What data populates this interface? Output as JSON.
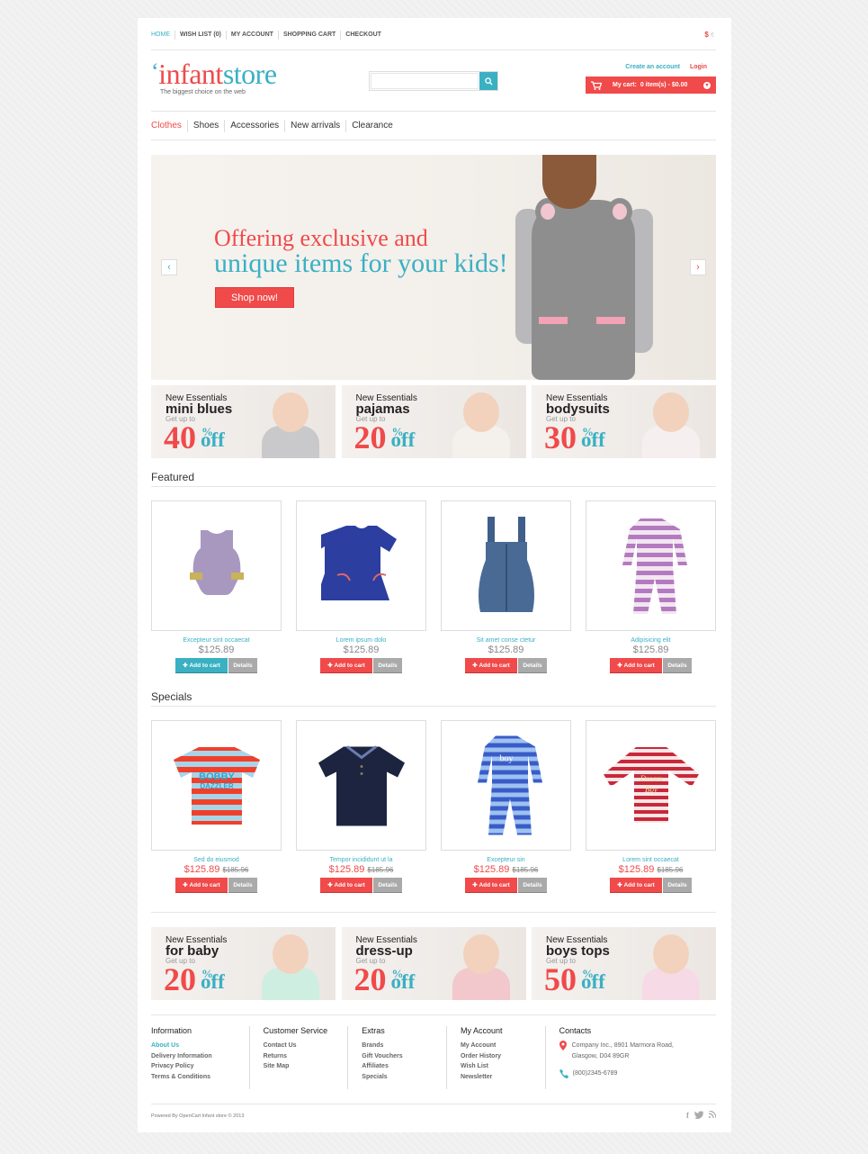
{
  "topnav": {
    "items": [
      "HOME",
      "WISH LIST (0)",
      "MY ACCOUNT",
      "SHOPPING CART",
      "CHECKOUT"
    ],
    "currency": "$",
    "currency_alt": "€"
  },
  "header": {
    "logo_quote": "‘",
    "logo_part1": "infant",
    "logo_part2": "store",
    "tagline": "The biggest choice on the web",
    "search_placeholder": "",
    "search_icon": "search-icon",
    "create_account": "Create an account",
    "login": "Login",
    "cart_label": "My cart:",
    "cart_value": "0 item(s) - $0.00"
  },
  "mainnav": [
    "Clothes",
    "Shoes",
    "Accessories",
    "New arrivals",
    "Clearance"
  ],
  "slider": {
    "line1": "Offering exclusive and",
    "line2": "unique items for your kids!",
    "button": "Shop now!",
    "prev": "‹",
    "next": "›"
  },
  "banners_top": [
    {
      "kicker": "New Essentials",
      "title": "mini blues",
      "sub": "Get up to",
      "pct": "40",
      "sym": "%",
      "off": "off"
    },
    {
      "kicker": "New Essentials",
      "title": "pajamas",
      "sub": "Get up to",
      "pct": "20",
      "sym": "%",
      "off": "off"
    },
    {
      "kicker": "New Essentials",
      "title": "bodysuits",
      "sub": "Get up to",
      "pct": "30",
      "sym": "%",
      "off": "off"
    }
  ],
  "featured": {
    "title": "Featured",
    "products": [
      {
        "name": "Excepteur sint occaecat",
        "price": "$125.89",
        "add": "Add to cart",
        "details": "Details"
      },
      {
        "name": "Lorem ipsum dolo",
        "price": "$125.89",
        "add": "Add to cart",
        "details": "Details"
      },
      {
        "name": "Sit amet conse ctetur",
        "price": "$125.89",
        "add": "Add to cart",
        "details": "Details"
      },
      {
        "name": "Adipisicing elit",
        "price": "$125.89",
        "add": "Add to cart",
        "details": "Details"
      }
    ]
  },
  "specials": {
    "title": "Specials",
    "products": [
      {
        "name": "Sed do eiusmod",
        "price": "$125.89",
        "old_price": "$185.96",
        "add": "Add to cart",
        "details": "Details",
        "print": "BOBBY DAZZLER"
      },
      {
        "name": "Tempor incididunt ut la",
        "price": "$125.89",
        "old_price": "$185.96",
        "add": "Add to cart",
        "details": "Details"
      },
      {
        "name": "Excepteur sin",
        "price": "$125.89",
        "old_price": "$185.96",
        "add": "Add to cart",
        "details": "Details",
        "print": "boy"
      },
      {
        "name": "Lorem sint occaecat",
        "price": "$125.89",
        "old_price": "$185.96",
        "add": "Add to cart",
        "details": "Details",
        "print": "Dream Boy"
      }
    ]
  },
  "banners_bottom": [
    {
      "kicker": "New Essentials",
      "title": "for baby",
      "sub": "Get up to",
      "pct": "20",
      "sym": "%",
      "off": "off"
    },
    {
      "kicker": "New Essentials",
      "title": "dress-up",
      "sub": "Get up to",
      "pct": "20",
      "sym": "%",
      "off": "off"
    },
    {
      "kicker": "New Essentials",
      "title": "boys tops",
      "sub": "Get up to",
      "pct": "50",
      "sym": "%",
      "off": "off"
    }
  ],
  "footer": {
    "columns": [
      {
        "title": "Information",
        "links": [
          "About Us",
          "Delivery Information",
          "Privacy Policy",
          "Terms & Conditions"
        ]
      },
      {
        "title": "Customer Service",
        "links": [
          "Contact Us",
          "Returns",
          "Site Map"
        ]
      },
      {
        "title": "Extras",
        "links": [
          "Brands",
          "Gift Vouchers",
          "Affiliates",
          "Specials"
        ]
      },
      {
        "title": "My Account",
        "links": [
          "My Account",
          "Order History",
          "Wish List",
          "Newsletter"
        ]
      }
    ],
    "contacts": {
      "title": "Contacts",
      "address_line1": "Company Inc., 8901 Marmora Road,",
      "address_line2": "Glasgow, D04 89GR",
      "phone": "(800)2345-6789"
    },
    "copyright": "Powered By OpenCart Infant store © 2013",
    "social": [
      "f",
      "t",
      "rss"
    ]
  },
  "colors": {
    "accent_red": "#f04a4a",
    "accent_teal": "#3ab0c3",
    "gray_button": "#aaaaaa"
  }
}
